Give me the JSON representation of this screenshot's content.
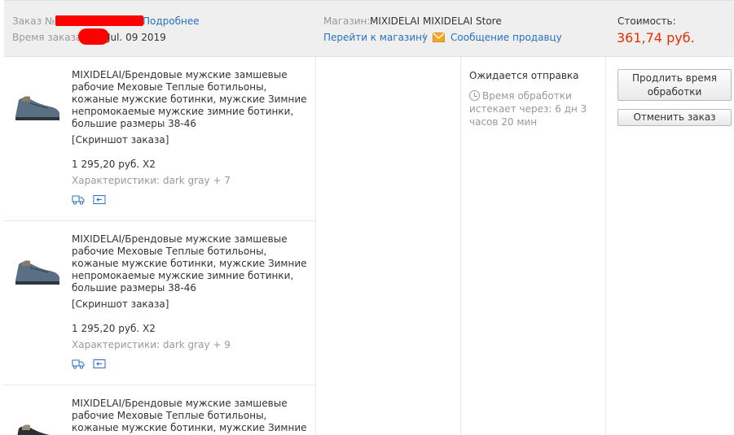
{
  "header": {
    "order_label": "Заказ №:",
    "details_link": "Подробнее",
    "order_time_label": "Время заказа:",
    "order_date": "Jul. 09 2019",
    "store_label": "Магазин:",
    "store_name": "MIXIDELAI MIXIDELAI Store",
    "goto_store": "Перейти к магазину",
    "link_divider": "|",
    "message_seller": "Сообщение продавцу",
    "cost_label": "Стоимость:",
    "cost_value": "361,74 руб."
  },
  "items": [
    {
      "title": "MIXIDELAI/Брендовые мужские замшевые рабочие Меховые Теплые ботильоны, кожаные мужские ботинки, мужские Зимние непромокаемые мужские зимние ботинки, большие размеры 38-46",
      "snapshot": "[Скриншот заказа]",
      "qty": "1 295,20 руб. X2",
      "props": "Характеристики: dark gray + 7"
    },
    {
      "title": "MIXIDELAI/Брендовые мужские замшевые рабочие Меховые Теплые ботильоны, кожаные мужские ботинки, мужские Зимние непромокаемые мужские зимние ботинки, большие размеры 38-46",
      "snapshot": "[Скриншот заказа]",
      "qty": "1 295,20 руб. X2",
      "props": "Характеристики: dark gray + 9"
    },
    {
      "title": "MIXIDELAI/Брендовые мужские замшевые рабочие Меховые Теплые ботильоны, кожаные мужские ботинки, мужские Зимние"
    }
  ],
  "status": {
    "text": "Ожидается отправка",
    "processing": "Время обработки истекает через: 6 дн 3 часов 20 мин"
  },
  "actions": {
    "extend": "Продлить время обработки",
    "cancel": "Отменить заказ"
  },
  "icons": {
    "shipping": "truck-icon",
    "return": "return-icon",
    "message": "envelope-icon",
    "clock": "clock-icon"
  },
  "colors": {
    "link": "#2970c2",
    "price": "#e62e04",
    "header_bg": "#efefef",
    "message_icon": "#f5a623",
    "redaction": "#ff0000"
  }
}
